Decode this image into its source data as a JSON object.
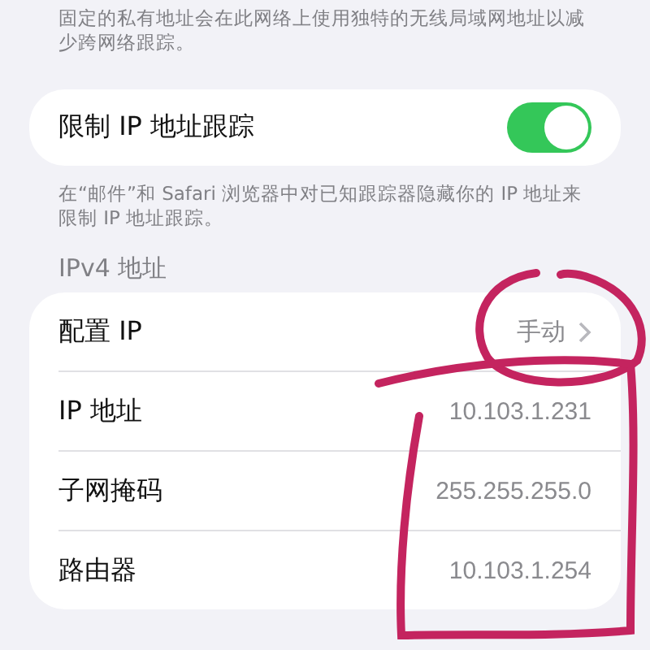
{
  "intro_note": "固定的私有地址会在此网络上使用独特的无线局域网地址以减少跨网络跟踪。",
  "limit_tracking": {
    "label": "限制 IP 地址跟踪",
    "on": true
  },
  "limit_tracking_note": "在“邮件”和 Safari 浏览器中对已知跟踪器隐藏你的 IP 地址来限制 IP 地址跟踪。",
  "ipv4": {
    "header": "IPv4 地址",
    "rows": [
      {
        "kind": "link",
        "label": "配置 IP",
        "value": "手动"
      },
      {
        "kind": "info",
        "label": "IP 地址",
        "value": "10.103.1.231"
      },
      {
        "kind": "info",
        "label": "子网掩码",
        "value": "255.255.255.0"
      },
      {
        "kind": "info",
        "label": "路由器",
        "value": "10.103.1.254"
      }
    ]
  }
}
